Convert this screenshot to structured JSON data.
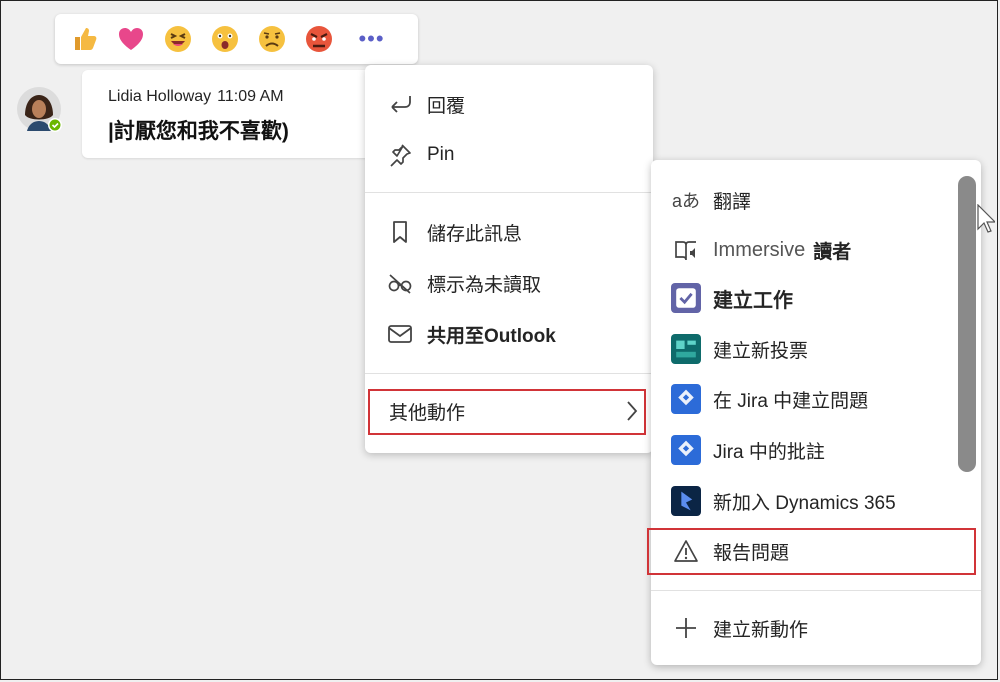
{
  "reactions": [
    {
      "name": "like",
      "color": "#f0b33b"
    },
    {
      "name": "heart",
      "color": "#e8478b"
    },
    {
      "name": "laugh",
      "color": "#f6c13f"
    },
    {
      "name": "surprised",
      "color": "#f6c13f"
    },
    {
      "name": "sad",
      "color": "#f6c13f"
    },
    {
      "name": "angry",
      "color": "#e8553b"
    }
  ],
  "more_label": "•••",
  "message": {
    "author": "Lidia Holloway",
    "time": "11:09 AM",
    "text": "|討厭您和我不喜歡)",
    "status_color": "#6bb700"
  },
  "menu1": {
    "reply": "回覆",
    "pin": "Pin",
    "save": "儲存此訊息",
    "unread": "標示為未讀取",
    "outlook": "共用至Outlook",
    "more_actions": "其他動作"
  },
  "menu2": {
    "translate": "翻譯",
    "translate_glyph": "aあ",
    "immersive_prefix": "Immersive",
    "immersive_suffix": "讀者",
    "create_task": "建立工作",
    "new_poll": "建立新投票",
    "jira_issue": "在 Jira 中建立問題",
    "jira_comment": "Jira 中的批註",
    "dynamics": "新加入 Dynamics 365",
    "report": "報告問題",
    "new_action": "建立新動作"
  },
  "colors": {
    "accent": "#5b5fc7",
    "highlight": "#d13438",
    "jira": "#2c6bd8",
    "poll": "#0e6b6b",
    "dynamics": "#0b2545"
  }
}
